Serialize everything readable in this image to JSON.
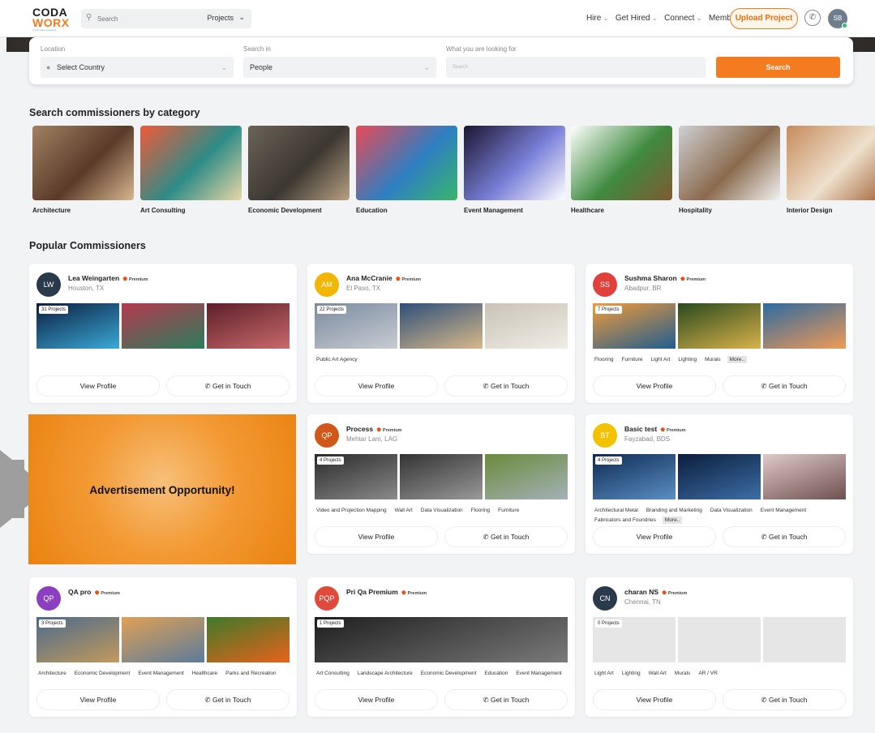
{
  "header": {
    "logo_line1": "CODA",
    "logo_line2": "WORX",
    "logo_tag": "commission managed",
    "search_placeholder": "Search",
    "search_scope": "Projects",
    "nav": [
      "Hire",
      "Get Hired",
      "Connect",
      "Membership"
    ],
    "upload_label": "Upload Project",
    "user_initials": "SB"
  },
  "search_panel": {
    "location_label": "Location",
    "location_value": "Select Country",
    "search_in_label": "Search in",
    "search_in_value": "People",
    "looking_label": "What you are looking for",
    "looking_placeholder": "Search",
    "search_button": "Search"
  },
  "categories_title": "Search commissioners by category",
  "categories": [
    {
      "name": "Architecture",
      "colors": [
        "#a18062",
        "#5a3b29",
        "#d9b790"
      ]
    },
    {
      "name": "Art Consulting",
      "colors": [
        "#f05a3a",
        "#2d8c87",
        "#e8d6a6"
      ]
    },
    {
      "name": "Economic Development",
      "colors": [
        "#6a6358",
        "#3c3731",
        "#b7a283"
      ]
    },
    {
      "name": "Education",
      "colors": [
        "#e84b55",
        "#2e7fc2",
        "#3ab56b"
      ]
    },
    {
      "name": "Event Management",
      "colors": [
        "#1a1630",
        "#7a7fd8",
        "#ffffff"
      ]
    },
    {
      "name": "Healthcare",
      "colors": [
        "#ffffff",
        "#3f8a3f",
        "#7f5a32"
      ]
    },
    {
      "name": "Hospitality",
      "colors": [
        "#cfcfd3",
        "#8a6a4d",
        "#f2f2f2"
      ]
    },
    {
      "name": "Interior Design",
      "colors": [
        "#c78a5b",
        "#eee0cc",
        "#a26136"
      ]
    }
  ],
  "popular_title": "Popular Commissioners",
  "card_labels": {
    "view": "View Profile",
    "touch": "Get in Touch",
    "premium": "Premium"
  },
  "commissioners": [
    {
      "initials": "LW",
      "name": "Lea Weingarten",
      "location": "Houston, TX",
      "avatar_color": "#2a3a4d",
      "projects": "31 Projects",
      "tags": [],
      "thumbs": [
        [
          "#0c1e3e",
          "#3aa9d8"
        ],
        [
          "#b5394f",
          "#2b7d5a"
        ],
        [
          "#5c1f2a",
          "#c96a6a"
        ]
      ]
    },
    {
      "initials": "AM",
      "name": "Ana McCranie",
      "location": "El Paso, TX",
      "avatar_color": "#f2b705",
      "projects": "22 Projects",
      "tags": [
        "Public Art Agency"
      ],
      "thumbs": [
        [
          "#7a8b9f",
          "#c8ccd2"
        ],
        [
          "#2f4f7a",
          "#d7b98a"
        ],
        [
          "#c9c3b6",
          "#f0ede6"
        ]
      ]
    },
    {
      "initials": "SS",
      "name": "Sushma Sharon",
      "location": "Abadpur, BR",
      "avatar_color": "#e0413a",
      "projects": "7 Projects",
      "tags": [
        "Flooring",
        "Furniture",
        "Light Art",
        "Lighting",
        "Murals"
      ],
      "more": "More..",
      "thumbs": [
        [
          "#f29b3a",
          "#1f5d8f"
        ],
        [
          "#2a4a1e",
          "#d9b24a"
        ],
        [
          "#2d6aa0",
          "#f09a56"
        ]
      ]
    },
    {
      "initials": "QP",
      "name": "Process",
      "location": "Mehtar Lam, LAG",
      "avatar_color": "#d2581a",
      "projects": "4 Projects",
      "tags": [
        "Video and Projection Mapping",
        "Wall Art",
        "Data Visualization",
        "Flooring",
        "Furniture"
      ],
      "thumbs": [
        [
          "#2a2a2a",
          "#8a8a8a"
        ],
        [
          "#333333",
          "#999999"
        ],
        [
          "#6b8a3a",
          "#a3b2b8"
        ]
      ]
    },
    {
      "initials": "BT",
      "name": "Basic test",
      "location": "Fayzabad, BDS",
      "avatar_color": "#f2c200",
      "projects": "4 Projects",
      "tags": [
        "Architectural Metal",
        "Branding and Marketing",
        "Data Visualization",
        "Event Management",
        "Fabricators and Foundries"
      ],
      "more": "More..",
      "thumbs": [
        [
          "#0e2a52",
          "#5a8fc4"
        ],
        [
          "#0b1d3b",
          "#3d6ea8"
        ],
        [
          "#e0c9c9",
          "#6e5050"
        ]
      ]
    },
    {
      "initials": "QP",
      "name": "QA pro",
      "location": "",
      "avatar_color": "#8c3fbf",
      "projects": "3 Projects",
      "tags": [
        "Architecture",
        "Economic Development",
        "Event Management",
        "Healthcare",
        "Parks and Recreation"
      ],
      "thumbs": [
        [
          "#4a6a8f",
          "#c29a5a"
        ],
        [
          "#e1a055",
          "#5b7c9a"
        ],
        [
          "#3e7a2a",
          "#e8621b"
        ]
      ]
    },
    {
      "initials": "PQP",
      "name": "Pri Qa Premium",
      "location": "",
      "avatar_color": "#e04a3a",
      "projects": "1 Projects",
      "tags": [
        "Art Consulting",
        "Landscape Architecture",
        "Economic Development",
        "Education",
        "Event Management"
      ],
      "thumbs": [
        [
          "#1e1e1e",
          "#7a7a7a"
        ]
      ]
    },
    {
      "initials": "CN",
      "name": "charan NS",
      "location": "Chennai, TN",
      "avatar_color": "#2a3a4d",
      "projects": "0 Projects",
      "tags": [
        "Light Art",
        "Lighting",
        "Wall Art",
        "Murals",
        "AR / VR"
      ],
      "thumbs": [
        [
          "#e6e6e6",
          "#e6e6e6"
        ],
        [
          "#e6e6e6",
          "#e6e6e6"
        ],
        [
          "#e6e6e6",
          "#e6e6e6"
        ]
      ]
    }
  ],
  "ad": {
    "text": "Advertisement Opportunity!"
  }
}
